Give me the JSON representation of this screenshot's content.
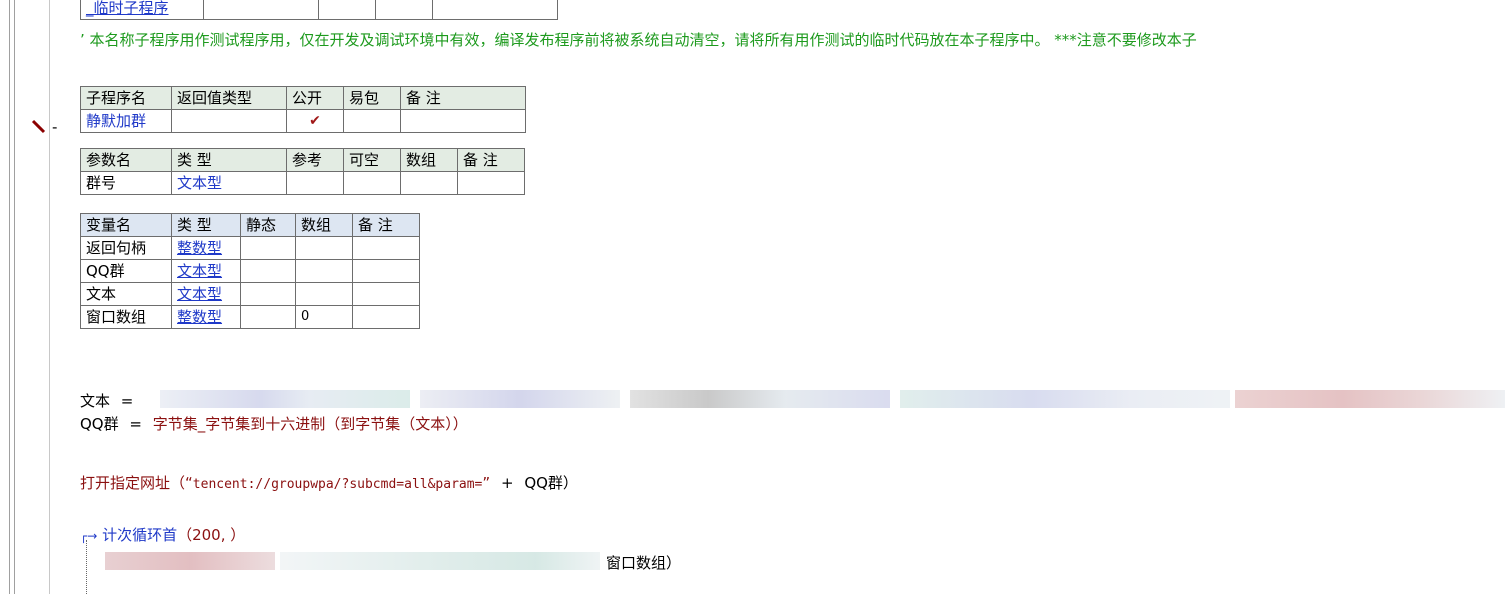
{
  "top_row": {
    "label": "_临时子程序"
  },
  "comment": "’ 本名称子程序用作测试程序用，仅在开发及调试环境中有效，编译发布程序前将被系统自动清空，请将所有用作测试的临时代码放在本子程序中。 ***注意不要修改本子",
  "sub_table": {
    "headers": [
      "子程序名",
      "返回值类型",
      "公开",
      "易包",
      "备 注"
    ],
    "name": "静默加群",
    "public_check": "✔"
  },
  "param_table": {
    "headers": [
      "参数名",
      "类 型",
      "参考",
      "可空",
      "数组",
      "备 注"
    ],
    "rows": [
      {
        "name": "群号",
        "type": "文本型"
      }
    ]
  },
  "var_table": {
    "headers": [
      "变量名",
      "类 型",
      "静态",
      "数组",
      "备 注"
    ],
    "rows": [
      {
        "name": "返回句柄",
        "type": "整数型",
        "array": ""
      },
      {
        "name": "QQ群",
        "type": "文本型",
        "array": ""
      },
      {
        "name": "文本",
        "type": "文本型",
        "array": ""
      },
      {
        "name": "窗口数组",
        "type": "整数型",
        "array": "0"
      }
    ]
  },
  "code": {
    "line1_var": "文本",
    "eq": "=",
    "line2_var": "QQ群",
    "line2_func": "字节集_字节集到十六进制",
    "line2_args": "（到字节集（文本））",
    "line3_func": "打开指定网址",
    "line3_open": "（“",
    "line3_url": "tencent://groupwpa/?subcmd=all&param=",
    "line3_close": "”",
    "line3_plus": "+",
    "line3_var": "QQ群）",
    "loop_arrow": "┌→",
    "loop_func": "计次循环首",
    "loop_args": "（200, ）",
    "loop_body_end": "窗口数组）"
  },
  "marker": {
    "dash": "-"
  }
}
